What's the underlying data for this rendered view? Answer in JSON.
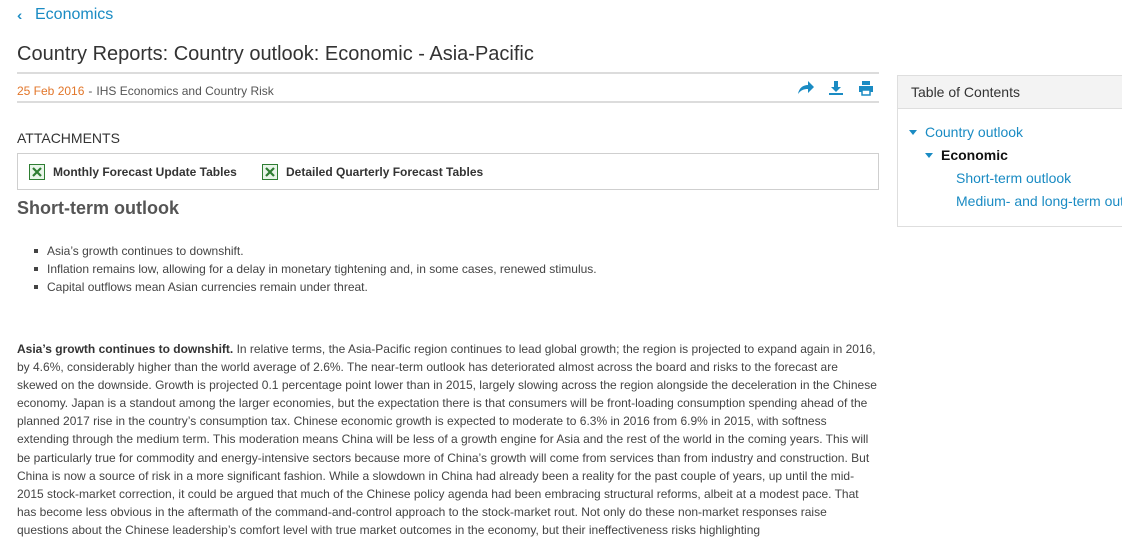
{
  "nav": {
    "back_label": "Economics"
  },
  "page": {
    "title": "Country Reports: Country outlook: Economic - Asia-Pacific"
  },
  "meta": {
    "date": "25 Feb 2016",
    "separator": "-",
    "source": "IHS Economics and Country Risk"
  },
  "toolbar": {
    "icons": [
      "share-icon",
      "download-icon",
      "print-icon"
    ]
  },
  "attachments": {
    "heading": "ATTACHMENTS",
    "items": [
      {
        "label": "Monthly Forecast Update Tables",
        "icon": "excel-file-icon"
      },
      {
        "label": "Detailed Quarterly Forecast Tables",
        "icon": "excel-file-icon"
      }
    ]
  },
  "article": {
    "section_title": "Short-term outlook",
    "bullets": [
      "Asia’s growth continues to downshift.",
      "Inflation remains low, allowing for a delay in monetary tightening and, in some cases, renewed stimulus.",
      "Capital outflows mean Asian currencies remain under threat."
    ],
    "paragraph_lead": "Asia’s growth continues to downshift.",
    "paragraph_body": " In relative terms, the Asia-Pacific region continues to lead global growth; the region is projected to expand again in 2016, by 4.6%, considerably higher than the world average of 2.6%. The near-term outlook has deteriorated almost across the board and risks to the forecast are skewed on the downside. Growth is projected 0.1 percentage point lower than in 2015, largely slowing across the region alongside the deceleration in the Chinese economy. Japan is a standout among the larger economies, but the expectation there is that consumers will be front-loading consumption spending ahead of the planned 2017 rise in the country’s consumption tax. Chinese economic growth is expected to moderate to 6.3% in 2016 from 6.9% in 2015, with softness extending through the medium term. This moderation means China will be less of a growth engine for Asia and the rest of the world in the coming years. This will be particularly true for commodity and energy-intensive sectors because more of China’s growth will come from services than from industry and construction. But China is now a source of risk in a more significant fashion. While a slowdown in China had already been a reality for the past couple of years, up until the mid-2015 stock-market correction, it could be argued that much of the Chinese policy agenda had been embracing structural reforms, albeit at a modest pace. That has become less obvious in the aftermath of the command-and-control approach to the stock-market rout. Not only do these non-market responses raise questions about the Chinese leadership’s comfort level with true market outcomes in the economy, but their ineffectiveness risks highlighting"
  },
  "toc": {
    "header": "Table of Contents",
    "items": {
      "country_outlook": "Country outlook",
      "economic": "Economic",
      "short_term": "Short-term outlook",
      "medium_long": "Medium- and long-term outlook"
    }
  },
  "colors": {
    "link": "#1a8bc3",
    "date": "#e2762a",
    "excel": "#2e7d32"
  }
}
